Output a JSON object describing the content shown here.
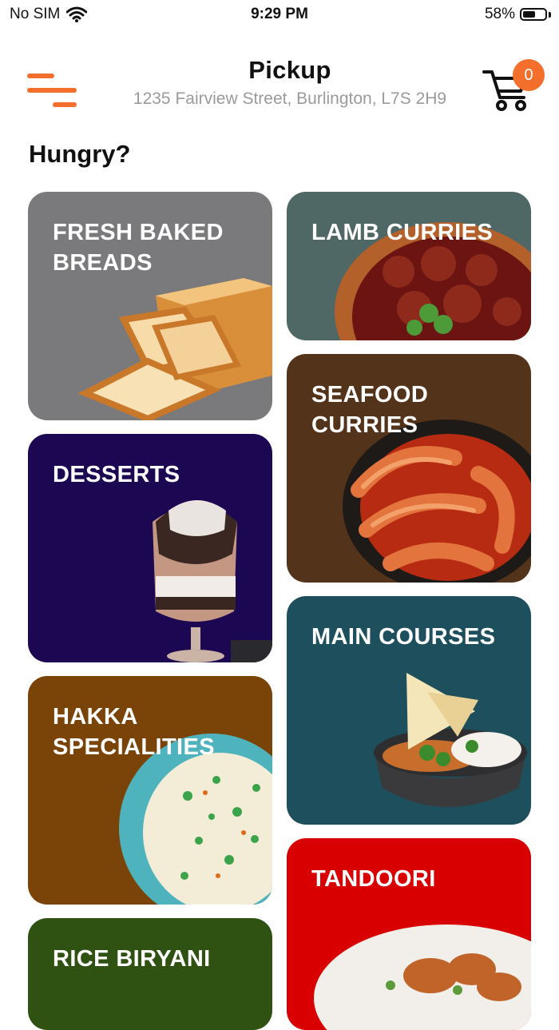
{
  "status_bar": {
    "carrier": "No SIM",
    "time": "9:29 PM",
    "battery": "58%",
    "battery_level": 0.58
  },
  "header": {
    "title": "Pickup",
    "address": "1235 Fairview Street, Burlington, L7S 2H9",
    "cart_count": "0",
    "accent_color": "#f36f2b"
  },
  "heading": "Hungry?",
  "categories": [
    {
      "label": "FRESH BAKED BREADS",
      "bg": "#7a797b",
      "icon": "bread-image"
    },
    {
      "label": "LAMB CURRIES",
      "bg": "#506865",
      "icon": "lamb-curry-image"
    },
    {
      "label": "DESSERTS",
      "bg": "#1c0752",
      "icon": "dessert-glass-image"
    },
    {
      "label": "SEAFOOD CURRIES",
      "bg": "#54331b",
      "icon": "shrimp-curry-image"
    },
    {
      "label": "HAKKA SPECIALITIES",
      "bg": "#7a4408",
      "icon": "fried-rice-image"
    },
    {
      "label": "MAIN COURSES",
      "bg": "#1e4f5d",
      "icon": "curry-bowl-image"
    },
    {
      "label": "RICE BIRYANI",
      "bg": "#2f5212",
      "icon": "biryani-image"
    },
    {
      "label": "TANDOORI",
      "bg": "#d80000",
      "icon": "tandoori-image"
    }
  ]
}
